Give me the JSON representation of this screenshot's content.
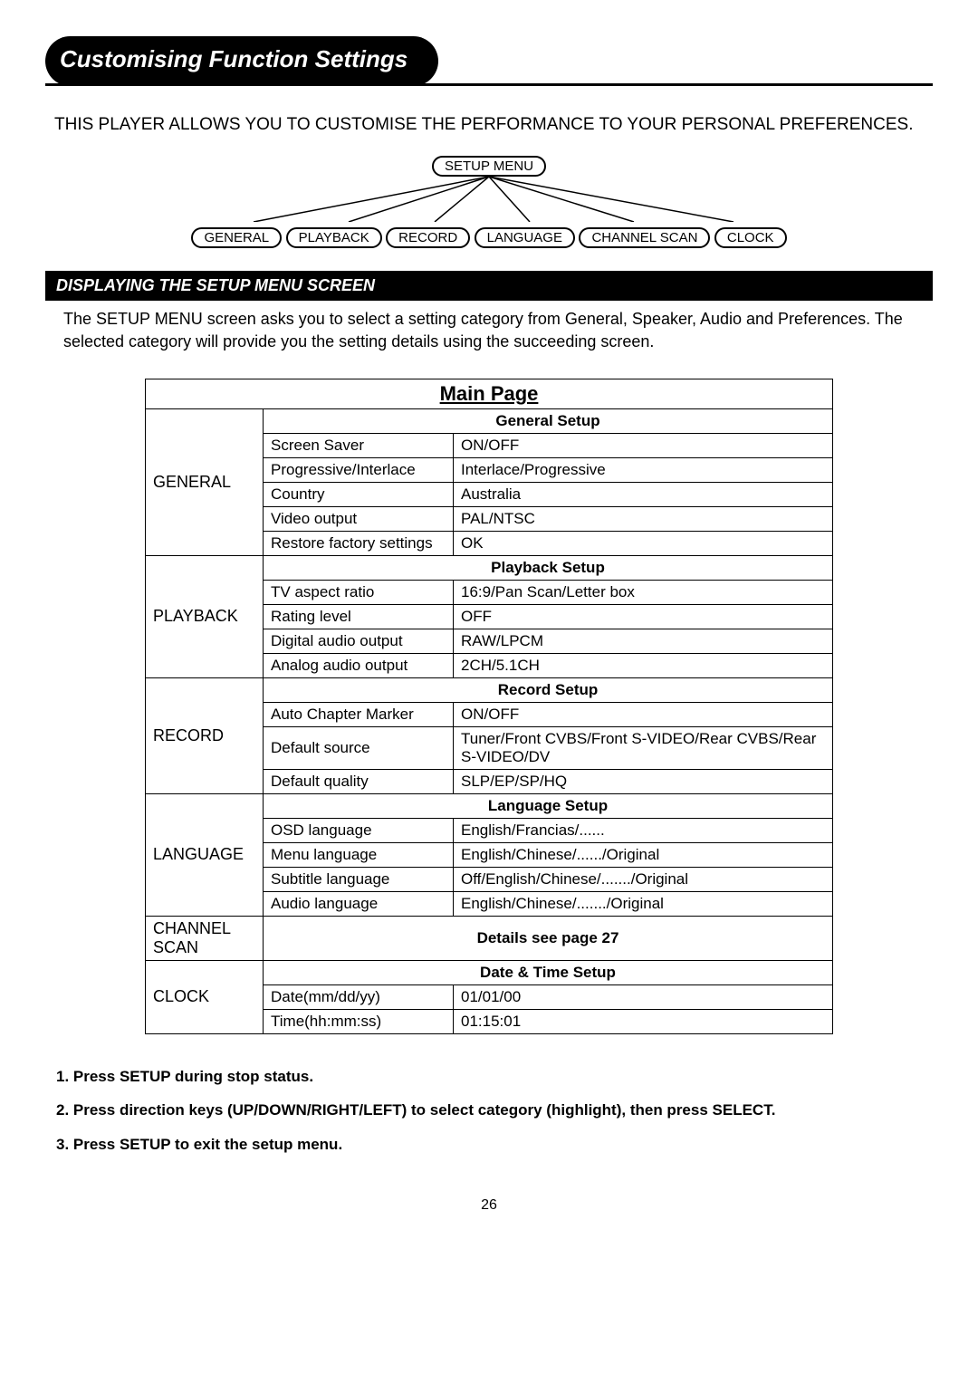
{
  "page_title": "Customising Function Settings",
  "intro": "THIS PLAYER ALLOWS YOU TO CUSTOMISE THE PERFORMANCE TO YOUR PERSONAL PREFERENCES.",
  "diagram": {
    "root": "SETUP MENU",
    "children": [
      "GENERAL",
      "PLAYBACK",
      "RECORD",
      "LANGUAGE",
      "CHANNEL SCAN",
      "CLOCK"
    ]
  },
  "section_bar": "DISPLAYING THE SETUP MENU SCREEN",
  "section_text": "The SETUP MENU screen asks you to select a setting category from General, Speaker, Audio and Preferences. The selected category will provide you the setting details using the succeeding screen.",
  "table": {
    "main_title": "Main Page",
    "groups": [
      {
        "label": "GENERAL",
        "header": "General Setup",
        "rows": [
          {
            "name": "Screen Saver",
            "value": "ON/OFF"
          },
          {
            "name": "Progressive/Interlace",
            "value": "Interlace/Progressive"
          },
          {
            "name": "Country",
            "value": "Australia"
          },
          {
            "name": "Video output",
            "value": "PAL/NTSC"
          },
          {
            "name": "Restore factory settings",
            "value": "OK"
          }
        ]
      },
      {
        "label": "PLAYBACK",
        "header": "Playback Setup",
        "rows": [
          {
            "name": "TV aspect ratio",
            "value": "16:9/Pan Scan/Letter box"
          },
          {
            "name": "Rating level",
            "value": "OFF"
          },
          {
            "name": "Digital audio output",
            "value": "RAW/LPCM"
          },
          {
            "name": "Analog audio output",
            "value": "2CH/5.1CH"
          }
        ]
      },
      {
        "label": "RECORD",
        "header": "Record Setup",
        "rows": [
          {
            "name": "Auto Chapter Marker",
            "value": "ON/OFF"
          },
          {
            "name": "Default source",
            "value": "Tuner/Front CVBS/Front S-VIDEO/Rear CVBS/Rear S-VIDEO/DV"
          },
          {
            "name": "Default quality",
            "value": "SLP/EP/SP/HQ"
          }
        ]
      },
      {
        "label": "LANGUAGE",
        "header": "Language Setup",
        "rows": [
          {
            "name": "OSD language",
            "value": "English/Francias/......"
          },
          {
            "name": "Menu language",
            "value": "English/Chinese/....../Original"
          },
          {
            "name": "Subtitle language",
            "value": "Off/English/Chinese/......./Original"
          },
          {
            "name": "Audio language",
            "value": "English/Chinese/......./Original"
          }
        ]
      },
      {
        "label": "CHANNEL SCAN",
        "header": "Details see page 27",
        "rows": []
      },
      {
        "label": "CLOCK",
        "header": "Date & Time Setup",
        "rows": [
          {
            "name": "Date(mm/dd/yy)",
            "value": "01/01/00"
          },
          {
            "name": "Time(hh:mm:ss)",
            "value": "01:15:01"
          }
        ]
      }
    ]
  },
  "instructions": [
    "1. Press SETUP during stop status.",
    "2. Press direction keys (UP/DOWN/RIGHT/LEFT) to select category (highlight), then press SELECT.",
    "3. Press SETUP to exit the setup menu."
  ],
  "page_number": "26"
}
